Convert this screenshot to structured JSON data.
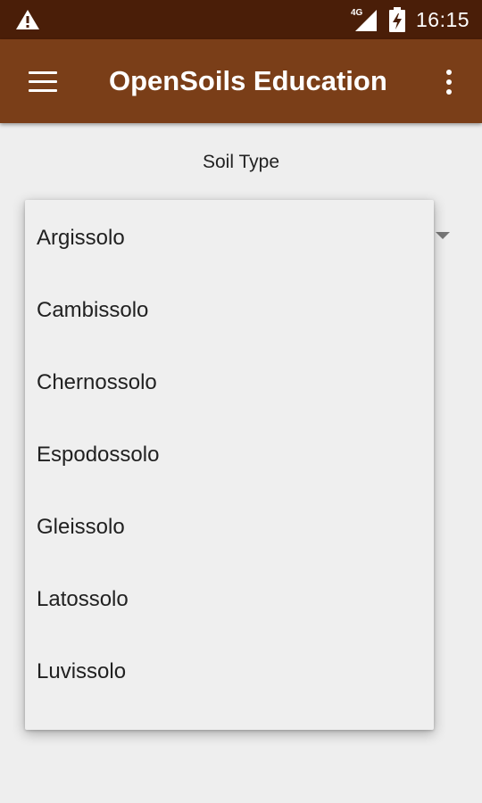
{
  "status_bar": {
    "network_label": "4G",
    "time": "16:15",
    "icons": [
      "warning-icon",
      "signal-icon",
      "battery-charging-icon"
    ]
  },
  "app_bar": {
    "title": "OpenSoils Education",
    "icons": [
      "menu-icon",
      "more-vert-icon"
    ]
  },
  "form": {
    "field_label": "Soil Type"
  },
  "dropdown": {
    "options": [
      "Argissolo",
      "Cambissolo",
      "Chernossolo",
      "Espodossolo",
      "Gleissolo",
      "Latossolo",
      "Luvissolo"
    ]
  },
  "colors": {
    "status_bar_bg": "#4a1e08",
    "app_bar_bg": "#7a3e18",
    "page_bg": "#eeeeee"
  }
}
